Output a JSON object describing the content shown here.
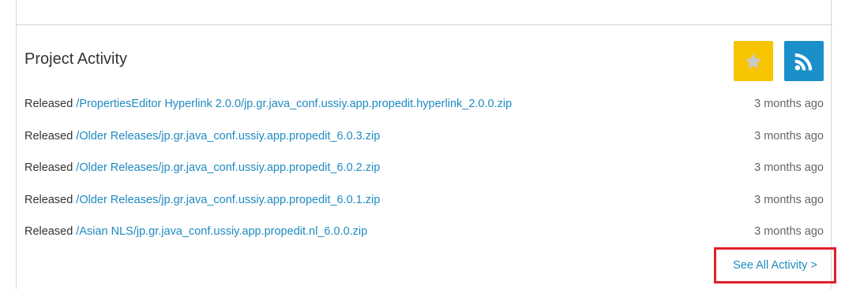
{
  "section": {
    "title": "Project Activity"
  },
  "buttons": {
    "star_icon": "star-icon",
    "rss_icon": "rss-icon",
    "star_color": "#f7c400",
    "rss_color": "#1a8fc9"
  },
  "activity": [
    {
      "verb": "Released",
      "path": "/PropertiesEditor Hyperlink 2.0.0/jp.gr.java_conf.ussiy.app.propedit.hyperlink_2.0.0.zip",
      "time": "3 months ago"
    },
    {
      "verb": "Released",
      "path": "/Older Releases/jp.gr.java_conf.ussiy.app.propedit_6.0.3.zip",
      "time": "3 months ago"
    },
    {
      "verb": "Released",
      "path": "/Older Releases/jp.gr.java_conf.ussiy.app.propedit_6.0.2.zip",
      "time": "3 months ago"
    },
    {
      "verb": "Released",
      "path": "/Older Releases/jp.gr.java_conf.ussiy.app.propedit_6.0.1.zip",
      "time": "3 months ago"
    },
    {
      "verb": "Released",
      "path": "/Asian NLS/jp.gr.java_conf.ussiy.app.propedit.nl_6.0.0.zip",
      "time": "3 months ago"
    }
  ],
  "footer": {
    "see_all_label": "See All Activity >",
    "highlight_color": "#e0202a"
  }
}
